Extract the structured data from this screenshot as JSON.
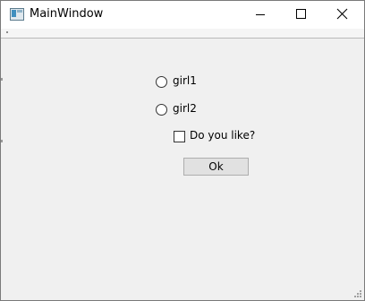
{
  "window": {
    "title": "MainWindow",
    "icon": "app-window-icon",
    "controls": {
      "minimize_icon": "minimize-icon",
      "maximize_icon": "maximize-icon",
      "close_icon": "close-icon"
    }
  },
  "form": {
    "radios": [
      {
        "label": "girl1",
        "checked": false
      },
      {
        "label": "girl2",
        "checked": false
      }
    ],
    "checkbox": {
      "label": "Do you like?",
      "checked": false
    },
    "button": {
      "label": "Ok"
    }
  },
  "colors": {
    "titlebar": "#ffffff",
    "client_area": "#f0f0f0",
    "button_face": "#e1e1e1",
    "button_border": "#adadad"
  }
}
